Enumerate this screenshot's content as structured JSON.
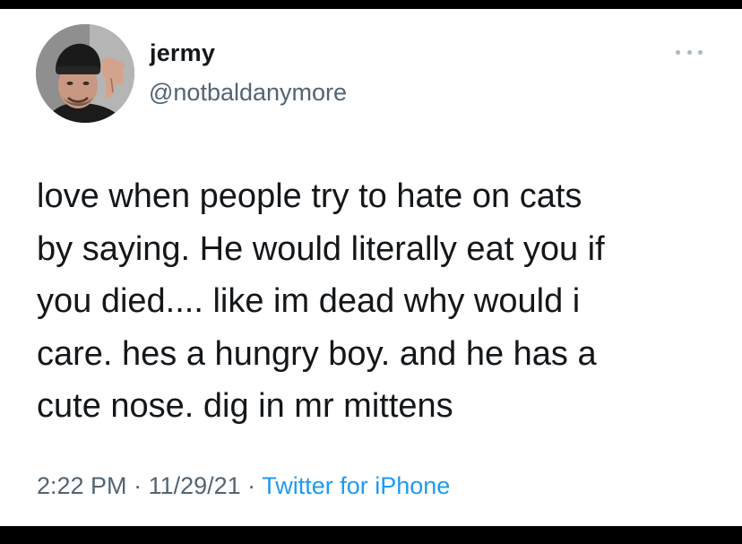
{
  "tweet": {
    "display_name": "jermy",
    "handle": "@notbaldanymore",
    "text": "love when people try to hate on cats\nby saying. He would literally eat you if\nyou died.... like im dead why would i\ncare. hes a hungry boy. and he has a\ncute nose. dig in mr mittens",
    "time": "2:22 PM",
    "separator": " · ",
    "date": "11/29/21",
    "source": "Twitter for iPhone"
  },
  "colors": {
    "background": "#ffffff",
    "text": "#14171a",
    "secondary": "#536471",
    "link": "#1d9bf0",
    "frame": "#000000"
  },
  "icons": {
    "more": "more-options-icon",
    "avatar": "profile-photo"
  }
}
